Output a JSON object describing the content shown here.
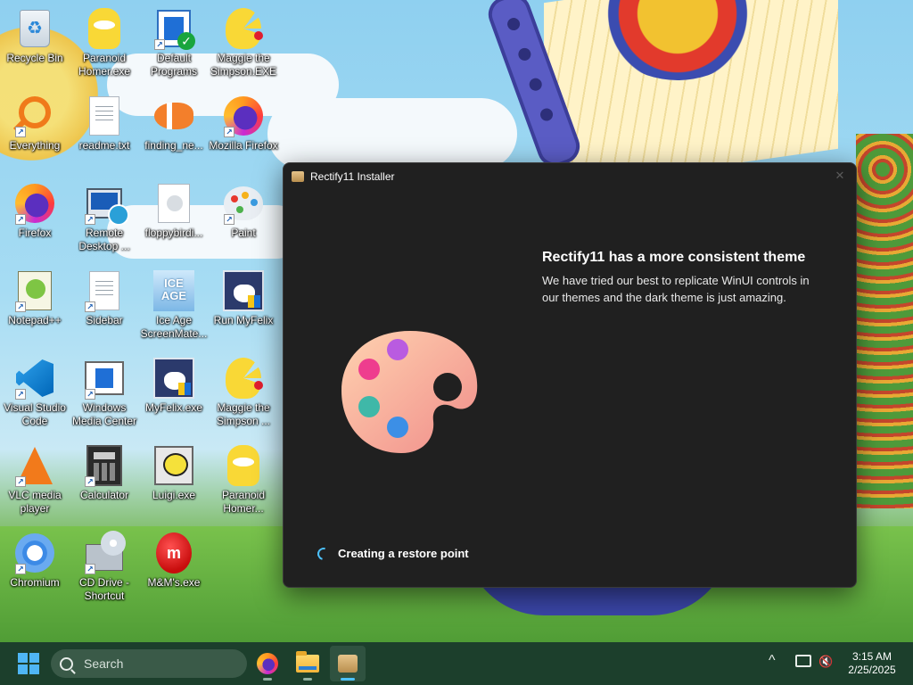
{
  "desktop": {
    "icons": [
      {
        "label": "Recycle Bin",
        "icon": "recycle-bin-icon"
      },
      {
        "label": "Paranoid Homer.exe",
        "icon": "homer-simpson-icon"
      },
      {
        "label": "Default Programs",
        "icon": "default-programs-icon"
      },
      {
        "label": "Maggie the Simpson.EXE",
        "icon": "maggie-simpson-icon"
      },
      {
        "label": "Everything",
        "icon": "everything-search-icon"
      },
      {
        "label": "readme.txt",
        "icon": "text-document-icon"
      },
      {
        "label": "finding_ne...",
        "icon": "clownfish-icon"
      },
      {
        "label": "Mozilla Firefox",
        "icon": "firefox-icon"
      },
      {
        "label": "Firefox",
        "icon": "firefox-icon"
      },
      {
        "label": "Remote Desktop ...",
        "icon": "remote-desktop-icon"
      },
      {
        "label": "floppybirdi...",
        "icon": "file-icon"
      },
      {
        "label": "Paint",
        "icon": "paint-palette-icon"
      },
      {
        "label": "Notepad++",
        "icon": "notepad-plus-plus-icon"
      },
      {
        "label": "Sidebar",
        "icon": "blank-file-icon"
      },
      {
        "label": "Ice Age ScreenMate...",
        "icon": "ice-age-icon"
      },
      {
        "label": "Run MyFelix",
        "icon": "felix-cat-icon"
      },
      {
        "label": "Visual Studio Code",
        "icon": "vscode-icon"
      },
      {
        "label": "Windows Media Center",
        "icon": "media-center-icon"
      },
      {
        "label": "MyFelix.exe",
        "icon": "felix-cat-icon"
      },
      {
        "label": "Maggie the Simpson ...",
        "icon": "maggie-simpson-icon"
      },
      {
        "label": "VLC media player",
        "icon": "vlc-cone-icon"
      },
      {
        "label": "Calculator",
        "icon": "calculator-icon"
      },
      {
        "label": "Luigi.exe",
        "icon": "luigi-computer-icon"
      },
      {
        "label": "Paranoid Homer...",
        "icon": "homer-simpson-icon"
      },
      {
        "label": "Chromium",
        "icon": "chromium-icon"
      },
      {
        "label": "CD Drive - Shortcut",
        "icon": "cd-drive-icon"
      },
      {
        "label": "M&M's.exe",
        "icon": "mm-candy-icon"
      }
    ]
  },
  "installer": {
    "title": "Rectify11 Installer",
    "close_glyph": "✕",
    "heading": "Rectify11 has a more consistent theme",
    "description": "We have tried our best to replicate WinUI controls in our themes and the dark theme is just amazing.",
    "status": "Creating a restore point",
    "illustration": "paint-palette-icon"
  },
  "taskbar": {
    "search_label": "Search",
    "apps": [
      {
        "name": "Firefox",
        "icon": "firefox-icon"
      },
      {
        "name": "File Explorer",
        "icon": "folder-icon"
      },
      {
        "name": "Rectify11 Installer",
        "icon": "installer-icon",
        "active": true
      }
    ],
    "tray": {
      "chevron": "^",
      "network_icon": "network-icon",
      "volume_icon": "volume-muted-icon"
    },
    "clock": {
      "time": "3:15 AM",
      "date": "2/25/2025"
    }
  },
  "colors": {
    "window_bg": "#202020",
    "accent": "#4cc2ff",
    "taskbar_bg": "#1c3f2c"
  }
}
